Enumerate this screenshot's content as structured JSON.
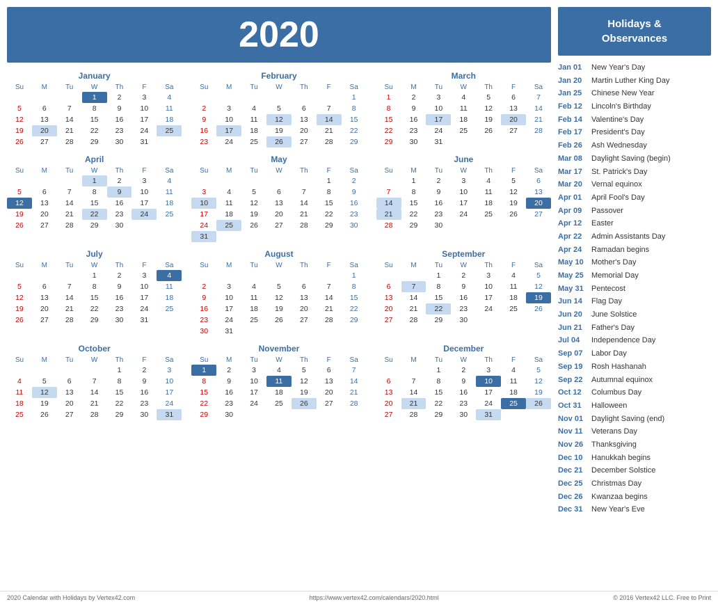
{
  "header": {
    "year": "2020"
  },
  "sidebar": {
    "title": "Holidays &\nObservances",
    "holidays": [
      {
        "date": "Jan 01",
        "name": "New Year's Day"
      },
      {
        "date": "Jan 20",
        "name": "Martin Luther King Day"
      },
      {
        "date": "Jan 25",
        "name": "Chinese New Year"
      },
      {
        "date": "Feb 12",
        "name": "Lincoln's Birthday"
      },
      {
        "date": "Feb 14",
        "name": "Valentine's Day"
      },
      {
        "date": "Feb 17",
        "name": "President's Day"
      },
      {
        "date": "Feb 26",
        "name": "Ash Wednesday"
      },
      {
        "date": "Mar 08",
        "name": "Daylight Saving (begin)"
      },
      {
        "date": "Mar 17",
        "name": "St. Patrick's Day"
      },
      {
        "date": "Mar 20",
        "name": "Vernal equinox"
      },
      {
        "date": "Apr 01",
        "name": "April Fool's Day"
      },
      {
        "date": "Apr 09",
        "name": "Passover"
      },
      {
        "date": "Apr 12",
        "name": "Easter"
      },
      {
        "date": "Apr 22",
        "name": "Admin Assistants Day"
      },
      {
        "date": "Apr 24",
        "name": "Ramadan begins"
      },
      {
        "date": "May 10",
        "name": "Mother's Day"
      },
      {
        "date": "May 25",
        "name": "Memorial Day"
      },
      {
        "date": "May 31",
        "name": "Pentecost"
      },
      {
        "date": "Jun 14",
        "name": "Flag Day"
      },
      {
        "date": "Jun 20",
        "name": "June Solstice"
      },
      {
        "date": "Jun 21",
        "name": "Father's Day"
      },
      {
        "date": "Jul 04",
        "name": "Independence Day"
      },
      {
        "date": "Sep 07",
        "name": "Labor Day"
      },
      {
        "date": "Sep 19",
        "name": "Rosh Hashanah"
      },
      {
        "date": "Sep 22",
        "name": "Autumnal equinox"
      },
      {
        "date": "Oct 12",
        "name": "Columbus Day"
      },
      {
        "date": "Oct 31",
        "name": "Halloween"
      },
      {
        "date": "Nov 01",
        "name": "Daylight Saving (end)"
      },
      {
        "date": "Nov 11",
        "name": "Veterans Day"
      },
      {
        "date": "Nov 26",
        "name": "Thanksgiving"
      },
      {
        "date": "Dec 10",
        "name": "Hanukkah begins"
      },
      {
        "date": "Dec 21",
        "name": "December Solstice"
      },
      {
        "date": "Dec 25",
        "name": "Christmas Day"
      },
      {
        "date": "Dec 26",
        "name": "Kwanzaa begins"
      },
      {
        "date": "Dec 31",
        "name": "New Year's Eve"
      }
    ]
  },
  "footer": {
    "left": "2020 Calendar with Holidays by Vertex42.com",
    "center": "https://www.vertex42.com/calendars/2020.html",
    "right": "© 2016 Vertex42 LLC. Free to Print"
  },
  "months": [
    {
      "name": "January",
      "days": [
        [
          null,
          null,
          null,
          1,
          2,
          3,
          4
        ],
        [
          5,
          6,
          7,
          8,
          9,
          10,
          11
        ],
        [
          12,
          13,
          14,
          15,
          16,
          17,
          18
        ],
        [
          19,
          20,
          21,
          22,
          23,
          24,
          25
        ],
        [
          26,
          27,
          28,
          29,
          30,
          31,
          null
        ]
      ],
      "highlights": {
        "blue": [
          1
        ],
        "light": [
          20,
          25
        ]
      }
    },
    {
      "name": "February",
      "days": [
        [
          null,
          null,
          null,
          null,
          null,
          null,
          1
        ],
        [
          2,
          3,
          4,
          5,
          6,
          7,
          8
        ],
        [
          9,
          10,
          11,
          12,
          13,
          14,
          15
        ],
        [
          16,
          17,
          18,
          19,
          20,
          21,
          22
        ],
        [
          23,
          24,
          25,
          26,
          27,
          28,
          29
        ]
      ],
      "highlights": {
        "blue": [],
        "light": [
          12,
          14,
          17,
          26
        ]
      }
    },
    {
      "name": "March",
      "days": [
        [
          1,
          2,
          3,
          4,
          5,
          6,
          7
        ],
        [
          8,
          9,
          10,
          11,
          12,
          13,
          14
        ],
        [
          15,
          16,
          17,
          18,
          19,
          20,
          21
        ],
        [
          22,
          23,
          24,
          25,
          26,
          27,
          28
        ],
        [
          29,
          30,
          31,
          null,
          null,
          null,
          null
        ]
      ],
      "highlights": {
        "blue": [],
        "light": [
          17,
          20
        ]
      }
    },
    {
      "name": "April",
      "days": [
        [
          null,
          null,
          null,
          1,
          2,
          3,
          4
        ],
        [
          5,
          6,
          7,
          8,
          9,
          10,
          11
        ],
        [
          12,
          13,
          14,
          15,
          16,
          17,
          18
        ],
        [
          19,
          20,
          21,
          22,
          23,
          24,
          25
        ],
        [
          26,
          27,
          28,
          29,
          30,
          null,
          null
        ]
      ],
      "highlights": {
        "blue": [
          12
        ],
        "light": [
          1,
          9,
          22,
          24
        ]
      }
    },
    {
      "name": "May",
      "days": [
        [
          null,
          null,
          null,
          null,
          null,
          1,
          2
        ],
        [
          3,
          4,
          5,
          6,
          7,
          8,
          9
        ],
        [
          10,
          11,
          12,
          13,
          14,
          15,
          16
        ],
        [
          17,
          18,
          19,
          20,
          21,
          22,
          23
        ],
        [
          24,
          25,
          26,
          27,
          28,
          29,
          30
        ],
        [
          31,
          null,
          null,
          null,
          null,
          null,
          null
        ]
      ],
      "highlights": {
        "blue": [],
        "light": [
          10,
          25,
          31
        ]
      }
    },
    {
      "name": "June",
      "days": [
        [
          null,
          1,
          2,
          3,
          4,
          5,
          6
        ],
        [
          7,
          8,
          9,
          10,
          11,
          12,
          13
        ],
        [
          14,
          15,
          16,
          17,
          18,
          19,
          20
        ],
        [
          21,
          22,
          23,
          24,
          25,
          26,
          27
        ],
        [
          28,
          29,
          30,
          null,
          null,
          null,
          null
        ]
      ],
      "highlights": {
        "blue": [
          20
        ],
        "light": [
          14,
          21
        ]
      }
    },
    {
      "name": "July",
      "days": [
        [
          null,
          null,
          null,
          1,
          2,
          3,
          4
        ],
        [
          5,
          6,
          7,
          8,
          9,
          10,
          11
        ],
        [
          12,
          13,
          14,
          15,
          16,
          17,
          18
        ],
        [
          19,
          20,
          21,
          22,
          23,
          24,
          25
        ],
        [
          26,
          27,
          28,
          29,
          30,
          31,
          null
        ]
      ],
      "highlights": {
        "blue": [
          4
        ],
        "light": []
      }
    },
    {
      "name": "August",
      "days": [
        [
          null,
          null,
          null,
          null,
          null,
          null,
          1
        ],
        [
          2,
          3,
          4,
          5,
          6,
          7,
          8
        ],
        [
          9,
          10,
          11,
          12,
          13,
          14,
          15
        ],
        [
          16,
          17,
          18,
          19,
          20,
          21,
          22
        ],
        [
          23,
          24,
          25,
          26,
          27,
          28,
          29
        ],
        [
          30,
          31,
          null,
          null,
          null,
          null,
          null
        ]
      ],
      "highlights": {
        "blue": [],
        "light": []
      }
    },
    {
      "name": "September",
      "days": [
        [
          null,
          null,
          1,
          2,
          3,
          4,
          5
        ],
        [
          6,
          7,
          8,
          9,
          10,
          11,
          12
        ],
        [
          13,
          14,
          15,
          16,
          17,
          18,
          19
        ],
        [
          20,
          21,
          22,
          23,
          24,
          25,
          26
        ],
        [
          27,
          28,
          29,
          30,
          null,
          null,
          null
        ]
      ],
      "highlights": {
        "blue": [
          19
        ],
        "light": [
          7,
          22
        ]
      }
    },
    {
      "name": "October",
      "days": [
        [
          null,
          null,
          null,
          null,
          1,
          2,
          3
        ],
        [
          4,
          5,
          6,
          7,
          8,
          9,
          10
        ],
        [
          11,
          12,
          13,
          14,
          15,
          16,
          17
        ],
        [
          18,
          19,
          20,
          21,
          22,
          23,
          24
        ],
        [
          25,
          26,
          27,
          28,
          29,
          30,
          31
        ]
      ],
      "highlights": {
        "blue": [],
        "light": [
          12,
          31
        ]
      }
    },
    {
      "name": "November",
      "days": [
        [
          1,
          2,
          3,
          4,
          5,
          6,
          7
        ],
        [
          8,
          9,
          10,
          11,
          12,
          13,
          14
        ],
        [
          15,
          16,
          17,
          18,
          19,
          20,
          21
        ],
        [
          22,
          23,
          24,
          25,
          26,
          27,
          28
        ],
        [
          29,
          30,
          null,
          null,
          null,
          null,
          null
        ]
      ],
      "highlights": {
        "blue": [
          1,
          11
        ],
        "light": [
          26
        ]
      }
    },
    {
      "name": "December",
      "days": [
        [
          null,
          null,
          1,
          2,
          3,
          4,
          5
        ],
        [
          6,
          7,
          8,
          9,
          10,
          11,
          12
        ],
        [
          13,
          14,
          15,
          16,
          17,
          18,
          19
        ],
        [
          20,
          21,
          22,
          23,
          24,
          25,
          26
        ],
        [
          27,
          28,
          29,
          30,
          31,
          null,
          null
        ]
      ],
      "highlights": {
        "blue": [
          10,
          25
        ],
        "light": [
          21,
          26,
          31
        ]
      }
    }
  ]
}
